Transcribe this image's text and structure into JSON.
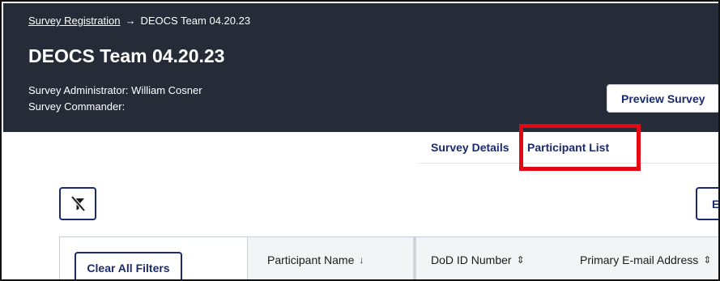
{
  "header": {
    "breadcrumb": {
      "parent": "Survey Registration",
      "arrow": "→",
      "current": "DEOCS Team 04.20.23"
    },
    "title": "DEOCS Team 04.20.23",
    "administrator": "Survey Administrator: William Cosner",
    "commander": "Survey Commander:",
    "preview_button": "Preview Survey"
  },
  "tabs": [
    {
      "label": "Survey Details",
      "active": false
    },
    {
      "label": "Participant List",
      "active": true,
      "highlighted": true
    }
  ],
  "toolbar": {
    "filter_icon": "filter-off-icon",
    "edit_button": "Ed"
  },
  "table": {
    "clear_filters": "Clear All Filters",
    "columns": [
      {
        "label": "Participant Name",
        "sort_glyph": "↓"
      },
      {
        "label": "DoD ID Number",
        "sort_glyph": "⇕"
      },
      {
        "label": "Primary E-mail Address",
        "sort_glyph": "⇕"
      }
    ]
  },
  "colors": {
    "header_bg": "#252c38",
    "accent": "#1a2a6c",
    "highlight": "#e30613"
  }
}
